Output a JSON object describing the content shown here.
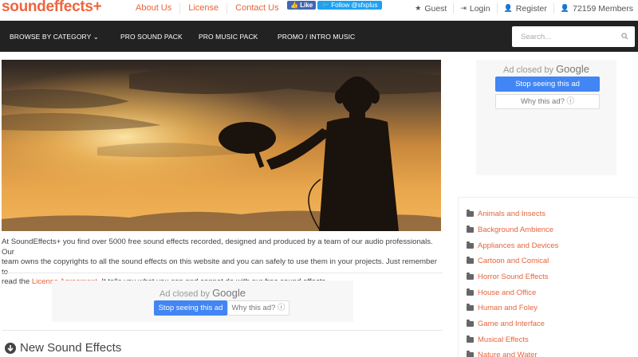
{
  "header": {
    "logo": "soundeffects+",
    "links": [
      "About Us",
      "License",
      "Contact Us"
    ],
    "facebook_label": "Like",
    "twitter_label": "Follow @sfxplus",
    "user": {
      "guest": "Guest",
      "login": "Login",
      "register": "Register",
      "members": "72159 Members"
    }
  },
  "nav": {
    "browse": "BROWSE BY CATEGORY",
    "pro_sound": "PRO SOUND PACK",
    "pro_music": "PRO MUSIC PACK",
    "promo": "PROMO / INTRO MUSIC",
    "search_placeholder": "Search..."
  },
  "intro": {
    "line1": "At SoundEffects+ you find over 5000 free sound effects recorded, designed and produced by a team of our audio professionals. Our",
    "line2": "team owns the copyrights to all the sound effects on this website and you can safely to use them in your projects. Just remember to",
    "line3_pre": "read the ",
    "line3_link": "License Agreement",
    "line3_post": ". It tells you what you can and cannot do with our free sound effects."
  },
  "ad": {
    "closed_by": "Ad closed by",
    "google": "Google",
    "stop": "Stop seeing this ad",
    "why": "Why this ad? ⓘ"
  },
  "new_sound_effects": "New Sound Effects",
  "categories": [
    "Animals and Insects",
    "Background Ambience",
    "Appliances and Devices",
    "Cartoon and Comical",
    "Horror Sound Effects",
    "House and Office",
    "Human and Foley",
    "Game and Interface",
    "Musical Effects",
    "Nature and Water"
  ],
  "colors": {
    "accent": "#f0643c",
    "nav_bg": "#222222",
    "google_blue": "#4285f4"
  }
}
